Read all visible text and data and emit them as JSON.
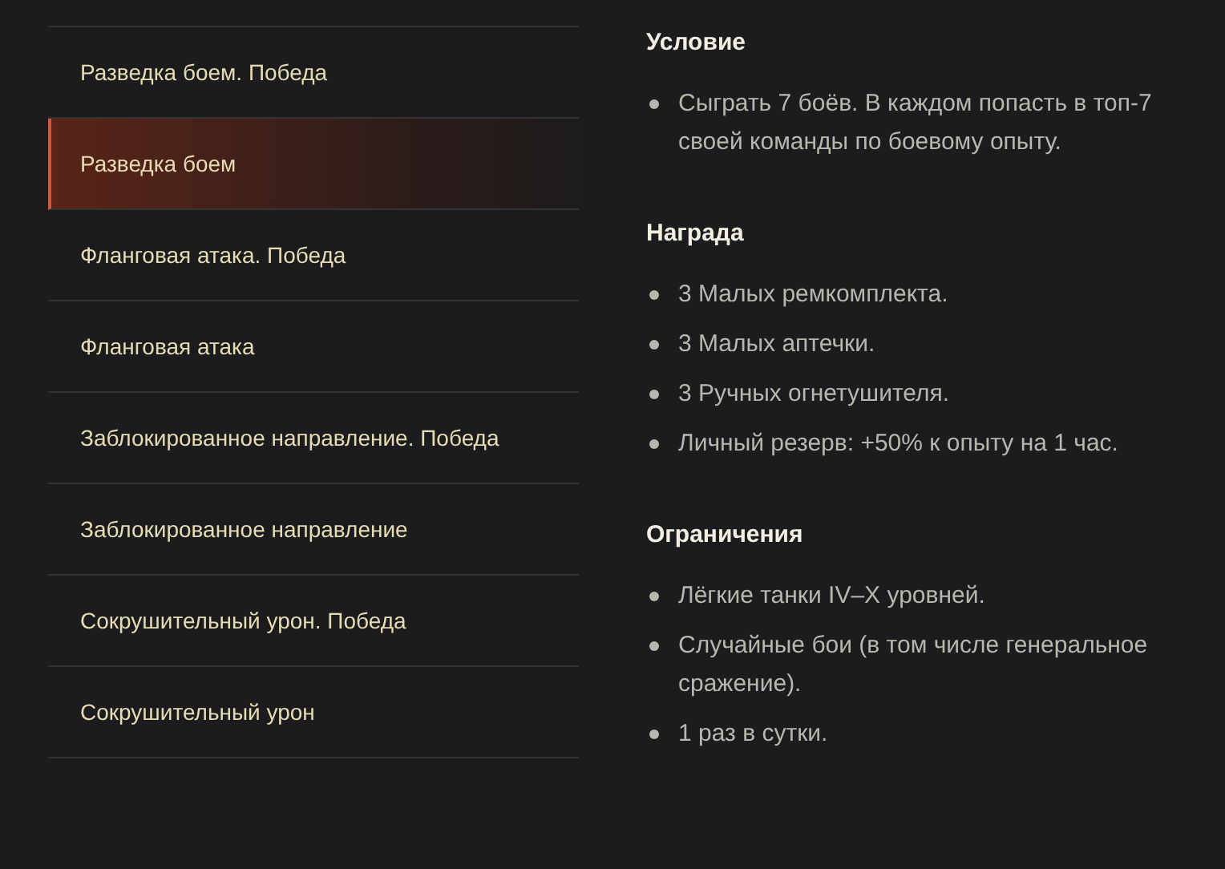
{
  "menu": [
    {
      "label": "Разведка боем. Победа",
      "selected": false
    },
    {
      "label": "Разведка боем",
      "selected": true
    },
    {
      "label": "Фланговая атака. Победа",
      "selected": false
    },
    {
      "label": "Фланговая атака",
      "selected": false
    },
    {
      "label": "Заблокированное направление. Победа",
      "selected": false
    },
    {
      "label": "Заблокированное направление",
      "selected": false
    },
    {
      "label": "Сокрушительный урон. Победа",
      "selected": false
    },
    {
      "label": "Сокрушительный урон",
      "selected": false
    }
  ],
  "sections": [
    {
      "title": "Условие",
      "items": [
        "Сыграть 7 боёв. В каждом попасть в топ-7 своей команды по боевому опыту."
      ]
    },
    {
      "title": "Награда",
      "items": [
        "3 Малых ремкомплекта.",
        "3 Малых аптечки.",
        "3 Ручных огнетушителя.",
        "Личный резерв: +50% к опыту на 1 час."
      ]
    },
    {
      "title": "Ограничения",
      "items": [
        "Лёгкие танки IV–X уровней.",
        "Случайные бои (в том числе генеральное сражение).",
        "1 раз в сутки."
      ]
    }
  ]
}
